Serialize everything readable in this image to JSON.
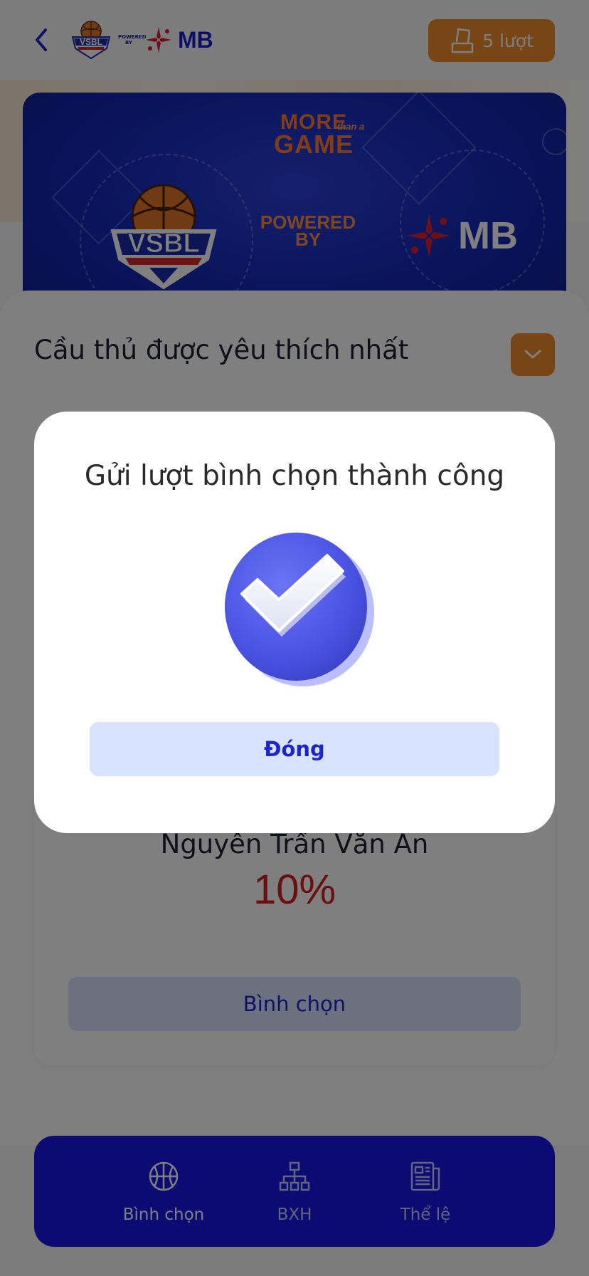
{
  "header": {
    "logo_powered_by": "POWERED BY",
    "logo_brand": "MB",
    "turns_label": "5 lượt"
  },
  "banner": {
    "more_line1": "MORE",
    "more_handwritten": "than a",
    "more_line2": "GAME",
    "powered_by": "POWERED BY",
    "brand": "MB"
  },
  "section": {
    "title": "Cầu thủ được yêu thích nhất"
  },
  "player": {
    "name": "Nguyễn Trần Văn An",
    "percent": "10%",
    "vote_label": "Bình chọn"
  },
  "bottom_nav": {
    "items": [
      {
        "label": "Bình chọn",
        "icon": "basketball-icon",
        "active": true
      },
      {
        "label": "BXH",
        "icon": "bracket-icon",
        "active": false
      },
      {
        "label": "Thể lệ",
        "icon": "document-icon",
        "active": false
      }
    ]
  },
  "modal": {
    "title": "Gửi lượt bình chọn thành công",
    "icon": "success-check-icon",
    "close_label": "Đóng"
  },
  "colors": {
    "accent_orange": "#f08a2b",
    "primary_blue": "#1616e6",
    "button_light_blue": "#d8e3ff",
    "percent_red": "#d41d1d"
  }
}
